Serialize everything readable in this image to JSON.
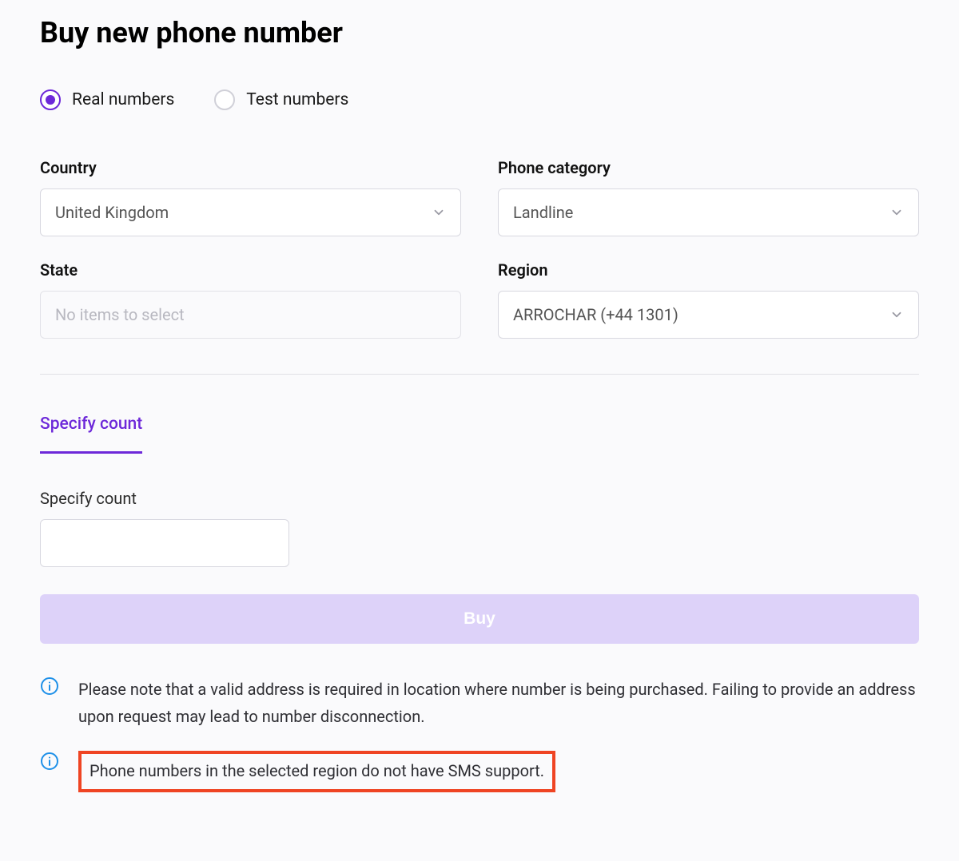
{
  "page": {
    "title": "Buy new phone number"
  },
  "radios": {
    "real": "Real numbers",
    "test": "Test numbers",
    "selected": "real"
  },
  "fields": {
    "country": {
      "label": "Country",
      "value": "United Kingdom"
    },
    "phone_category": {
      "label": "Phone category",
      "value": "Landline"
    },
    "state": {
      "label": "State",
      "placeholder": "No items to select"
    },
    "region": {
      "label": "Region",
      "value": "ARROCHAR (+44 1301)"
    }
  },
  "tabs": {
    "specify_count": "Specify count"
  },
  "count": {
    "label": "Specify count",
    "value": ""
  },
  "actions": {
    "buy": "Buy"
  },
  "notices": {
    "address": "Please note that a valid address is required in location where number is being purchased. Failing to provide an address upon request may lead to number disconnection.",
    "sms": "Phone numbers in the selected region do not have SMS support."
  },
  "colors": {
    "accent": "#6d28d9",
    "info_icon": "#1e90e8",
    "highlight": "#ef4423",
    "button_bg": "#ddd2f9"
  }
}
